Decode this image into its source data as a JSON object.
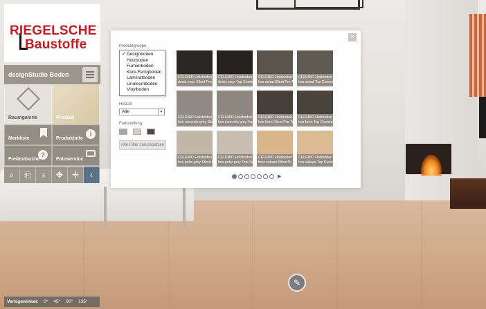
{
  "logo": {
    "line1": "RIEGELSCHE",
    "line2": "Baustoffe"
  },
  "sidebar": {
    "title": "designStudio Boden",
    "tiles": {
      "raumgalerie": "Raumgalerie",
      "produkt": "Produkt",
      "merkliste": "Merkliste",
      "produktinfo": "Produktinfo",
      "freitextsuche": "Freitextsuche",
      "fotoservice": "Fotoservice"
    },
    "info_glyph": "i",
    "help_glyph": "?",
    "toolbar": [
      "search-icon",
      "document-icon",
      "link-icon",
      "move-icon",
      "expand-icon",
      "chevron-left-icon"
    ]
  },
  "dialog": {
    "close": "×",
    "produktgruppe_label": "Produktgruppe",
    "produktgruppe_options": [
      {
        "label": "Designboden",
        "selected": true
      },
      {
        "label": "Holzboden",
        "selected": false
      },
      {
        "label": "Furnierboden",
        "selected": false
      },
      {
        "label": "Kork-Fertigboden",
        "selected": false
      },
      {
        "label": "Laminatboden",
        "selected": false
      },
      {
        "label": "Linoleumboden",
        "selected": false
      },
      {
        "label": "Vinylboden",
        "selected": false
      }
    ],
    "check_glyph": "✓",
    "holzart_label": "Holzart",
    "holzart_value": "Alle",
    "farbstellung_label": "Farbstellung",
    "swatches": [
      "#a9a6a3",
      "#d2cecb",
      "#5a4543"
    ],
    "reset_label": "Alle Filter zurücksetzen",
    "products": [
      {
        "line1": "CELENIO Holzboden At",
        "line2": "dosia onyx Silent Pro T",
        "color": "#2a2826"
      },
      {
        "line1": "CELENIO Holzboden At",
        "line2": "dosia onyx Top Connec",
        "color": "#25231f"
      },
      {
        "line1": "CELENIO Holzboden At",
        "line2": "hos achat Silent Pro To",
        "color": "#5b544d"
      },
      {
        "line1": "CELENIO Holzboden At",
        "line2": "hos achat Top Connect",
        "color": "#615a52"
      },
      {
        "line1": "CELENIO Holzboden At",
        "line2": "hos concrete grey Silen",
        "color": "#918a84"
      },
      {
        "line1": "CELENIO Holzboden At",
        "line2": "hos concrete grey Top",
        "color": "#8d8780"
      },
      {
        "line1": "CELENIO Holzboden At",
        "line2": "hos ferro Silent Pro To",
        "color": "#47403a"
      },
      {
        "line1": "CELENIO Holzboden At",
        "line2": "hos ferro Top Connect",
        "color": "#4a433c"
      },
      {
        "line1": "CELENIO Holzboden At",
        "line2": "hos polar grey Silent Pr",
        "color": "#c2b6a8"
      },
      {
        "line1": "CELENIO Holzboden At",
        "line2": "hos polar grey Top Con",
        "color": "#c8bdb1"
      },
      {
        "line1": "CELENIO Holzboden A",
        "line2": "thos sahara Silent Pr",
        "color": "#d9b58a"
      },
      {
        "line1": "CELENIO Holzboden At",
        "line2": "hos sahara Top Connect",
        "color": "#dcbb93"
      }
    ],
    "pager": {
      "pages": 7,
      "current": 1,
      "next": "▶"
    }
  },
  "angles": {
    "label": "Verlegewinkel:",
    "values": [
      "0°",
      "45°",
      "90°",
      "135°"
    ]
  },
  "edit_icon": "✎"
}
